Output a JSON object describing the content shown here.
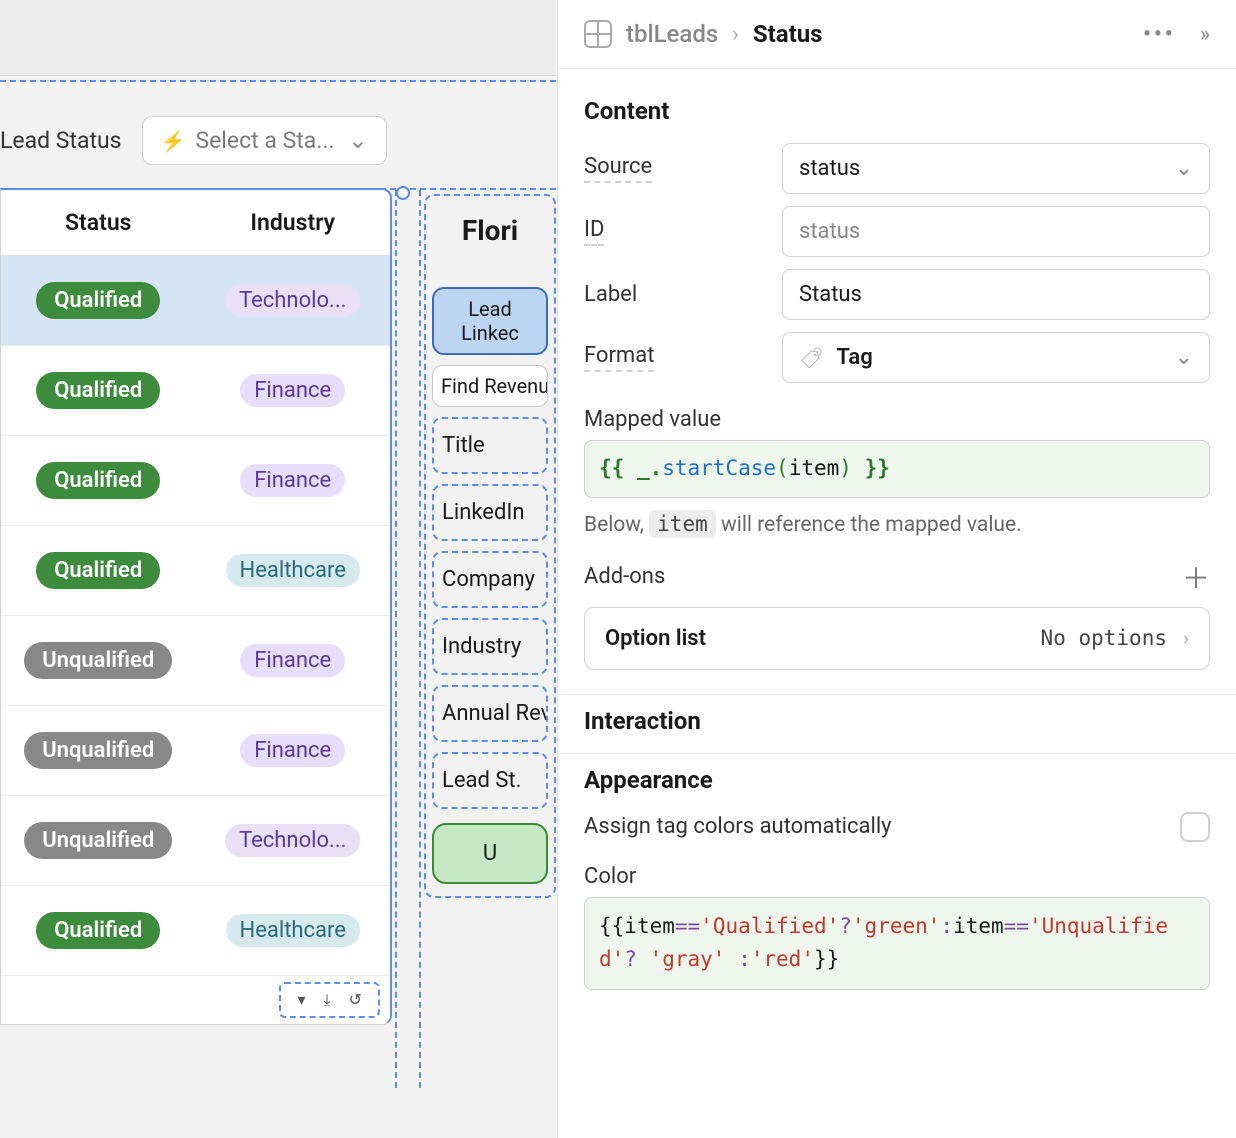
{
  "breadcrumb": {
    "table": "tblLeads",
    "field": "Status"
  },
  "leftHeader": {
    "leadStatusLabel": "Lead Status",
    "selectPlaceholder": "Select a Sta..."
  },
  "table": {
    "headers": {
      "status": "Status",
      "industry": "Industry"
    },
    "rows": [
      {
        "status": "Qualified",
        "statusColor": "green",
        "industry": "Technolo...",
        "industryClass": "technology",
        "selected": true
      },
      {
        "status": "Qualified",
        "statusColor": "green",
        "industry": "Finance",
        "industryClass": "finance"
      },
      {
        "status": "Qualified",
        "statusColor": "green",
        "industry": "Finance",
        "industryClass": "finance"
      },
      {
        "status": "Qualified",
        "statusColor": "green",
        "industry": "Healthcare",
        "industryClass": "healthcare"
      },
      {
        "status": "Unqualified",
        "statusColor": "gray",
        "industry": "Finance",
        "industryClass": "finance"
      },
      {
        "status": "Unqualified",
        "statusColor": "gray",
        "industry": "Finance",
        "industryClass": "finance"
      },
      {
        "status": "Unqualified",
        "statusColor": "gray",
        "industry": "Technolo...",
        "industryClass": "technology"
      },
      {
        "status": "Qualified",
        "statusColor": "green",
        "industry": "Healthcare",
        "industryClass": "healthcare"
      }
    ]
  },
  "detailCard": {
    "title": "Flori",
    "leadTag": "Lead Linkec",
    "findChip": "Find Revenu",
    "fields": [
      "Title",
      "LinkedIn",
      "Company",
      "Industry",
      "Annual Revenue",
      "Lead St."
    ],
    "greenChip": "U"
  },
  "panel": {
    "contentTitle": "Content",
    "source": {
      "label": "Source",
      "value": "status"
    },
    "id": {
      "label": "ID",
      "placeholder": "status"
    },
    "labelField": {
      "label": "Label",
      "value": "Status"
    },
    "format": {
      "label": "Format",
      "value": "Tag"
    },
    "mapped": {
      "title": "Mapped value",
      "code": {
        "open": "{{ ",
        "underscoreDot": "_.",
        "fn": "startCase",
        "openParen": "(",
        "arg": "item",
        "closeParen": ")",
        "close": " }}"
      },
      "noteBefore": "Below, ",
      "noteChip": "item",
      "noteAfter": " will reference the mapped value."
    },
    "addons": {
      "title": "Add-ons",
      "optionLabel": "Option list",
      "optionValue": "No options"
    },
    "interactionTitle": "Interaction",
    "appearanceTitle": "Appearance",
    "autoColors": "Assign tag colors automatically",
    "colorTitle": "Color",
    "colorCode": {
      "t1": "{{",
      "t2": "item",
      "t3": "==",
      "t4": "'Qualified'",
      "t5": "?",
      "t6": "'green'",
      "t7": ":",
      "t8": "item",
      "t9": "==",
      "t10": "'Unqualified'",
      "t11": "? ",
      "t12": "'gray'",
      "t13": " :",
      "t14": "'red'",
      "t15": "}}"
    }
  }
}
